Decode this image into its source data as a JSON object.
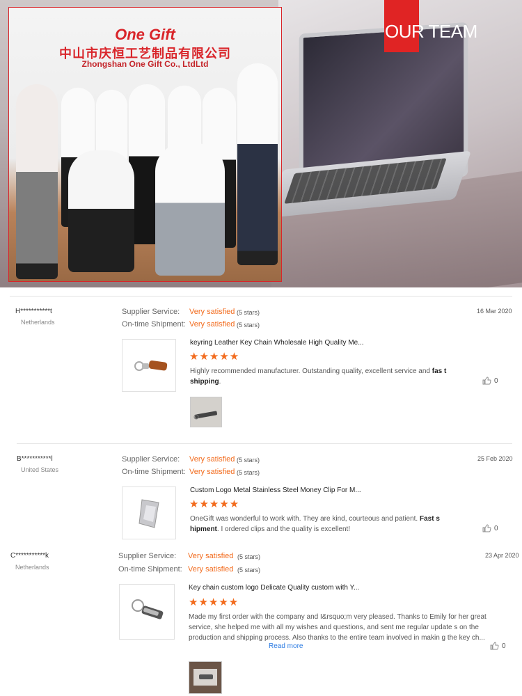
{
  "hero": {
    "badge_text": "OUR TEAM",
    "brand_logo_text": "One Gift",
    "company_cn": "中山市庆恒工艺制品有限公司",
    "company_en": "Zhongshan One Gift Co., LtdLtd"
  },
  "labels": {
    "supplier_service": "Supplier Service:",
    "ontime_shipment": "On-time Shipment:",
    "read_more": "Read more"
  },
  "reviews": [
    {
      "user": "H***********t",
      "country": "Netherlands",
      "date": "16 Mar 2020",
      "supplier_rating": "Very satisfied",
      "supplier_stars": "(5 stars)",
      "shipment_rating": "Very satisfied",
      "shipment_stars": "(5 stars)",
      "product_title": "keyring Leather Key Chain Wholesale High Quality Me...",
      "stars": "★★★★★",
      "text_plain": "Highly recommended manufacturer. Outstanding quality, excellent service and ",
      "text_bold": "fas t shipping",
      "text_end": ".",
      "likes": "0"
    },
    {
      "user": "B***********l",
      "country": "United States",
      "date": "25 Feb 2020",
      "supplier_rating": "Very satisfied",
      "supplier_stars": "(5 stars)",
      "shipment_rating": "Very satisfied",
      "shipment_stars": "(5 stars)",
      "product_title": "Custom Logo Metal Stainless Steel Money Clip For M...",
      "stars": "★★★★★",
      "text_plain": "OneGift was wonderful to work with. They are kind, courteous and patient. ",
      "text_bold": "Fast s hipment",
      "text_end": ". I ordered clips and the quality is excellent!",
      "likes": "0"
    },
    {
      "user": "C***********k",
      "country": "Netherlands",
      "date": "23 Apr 2020",
      "supplier_rating": "Very satisfied",
      "supplier_stars": "(5 stars)",
      "shipment_rating": "Very satisfied",
      "shipment_stars": "(5 stars)",
      "product_title": "Key chain custom logo Delicate Quality custom with Y...",
      "stars": "★★★★★",
      "text_plain": "Made my first order with the company and I&rsquo;m very pleased. Thanks to Emily for her great service, she helped me with all my wishes and questions, and sent me regular update s on the production and shipping process. Also thanks to the entire team involved in makin g the key ch...",
      "likes": "0"
    }
  ],
  "colors": {
    "accent": "#f26b1d",
    "badge": "#e02424",
    "link": "#2a7ae2"
  }
}
